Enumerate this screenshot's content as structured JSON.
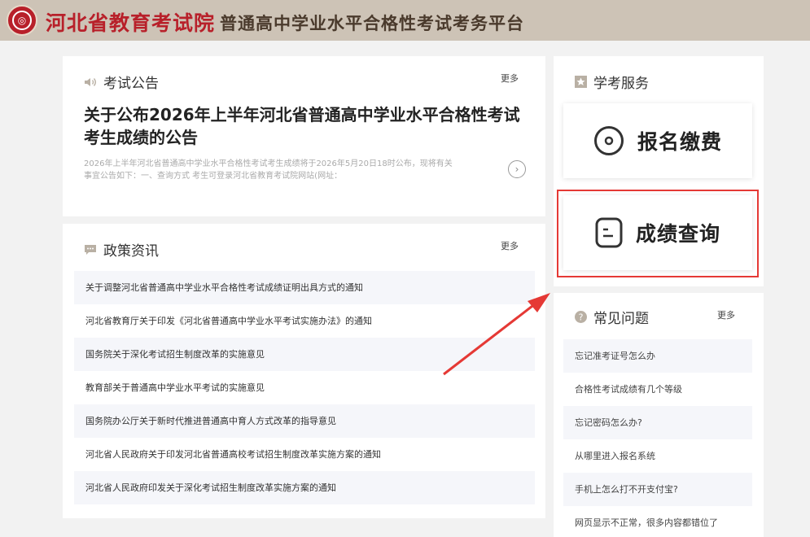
{
  "header": {
    "brand": "河北省教育考试院",
    "platform": "普通高中学业水平合格性考试考务平台",
    "logo_icon": "emblem-icon"
  },
  "announcement": {
    "section_title": "考试公告",
    "more": "更多",
    "title": "关于公布2026年上半年河北省普通高中学业水平合格性考试考生成绩的公告",
    "summary": "2026年上半年河北省普通高中学业水平合格性考试考生成绩将于2026年5月20日18时公布，现将有关事宜公告如下：一、查询方式 考生可登录河北省教育考试院网站(网址："
  },
  "policy": {
    "section_title": "政策资讯",
    "more": "更多",
    "items": [
      "关于调整河北省普通高中学业水平合格性考试成绩证明出具方式的通知",
      "河北省教育厅关于印发《河北省普通高中学业水平考试实施办法》的通知",
      "国务院关于深化考试招生制度改革的实施意见",
      "教育部关于普通高中学业水平考试的实施意见",
      "国务院办公厅关于新时代推进普通高中育人方式改革的指导意见",
      "河北省人民政府关于印发河北省普通高校考试招生制度改革实施方案的通知",
      "河北省人民政府印发关于深化考试招生制度改革实施方案的通知"
    ]
  },
  "services": {
    "section_title": "学考服务",
    "register_label": "报名缴费",
    "score_label": "成绩查询"
  },
  "faq": {
    "section_title": "常见问题",
    "more": "更多",
    "items": [
      "忘记准考证号怎么办",
      "合格性考试成绩有几个等级",
      "忘记密码怎么办?",
      "从哪里进入报名系统",
      "手机上怎么打不开支付宝?",
      "网页显示不正常，很多内容都错位了"
    ]
  },
  "colors": {
    "brand_red": "#b8202a",
    "header_bg": "#cdc3b6",
    "highlight": "#e53935"
  }
}
